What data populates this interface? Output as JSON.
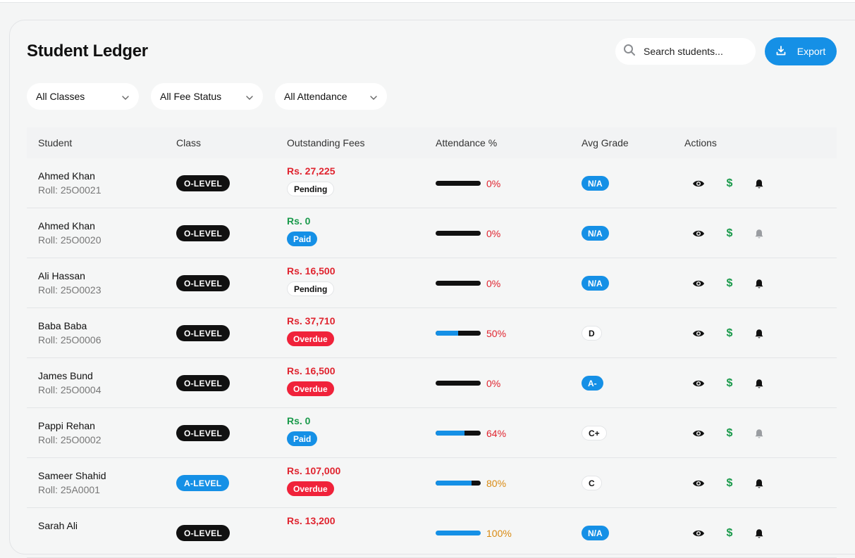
{
  "header": {
    "title": "Student Ledger"
  },
  "search": {
    "placeholder": "Search students..."
  },
  "export": {
    "label": "Export"
  },
  "filters": [
    {
      "label": "All Classes"
    },
    {
      "label": "All Fee Status"
    },
    {
      "label": "All Attendance"
    }
  ],
  "table": {
    "columns": [
      "Student",
      "Class",
      "Outstanding Fees",
      "Attendance %",
      "Avg Grade",
      "Actions"
    ],
    "rows": [
      {
        "name": "Ahmed Khan",
        "roll": "Roll: 25O0021",
        "class": "O-LEVEL",
        "fee": "Rs. 27,225",
        "status": "Pending",
        "attendance": 0,
        "attendance_label": "0%",
        "grade": "N/A",
        "reminder_enabled": true
      },
      {
        "name": "Ahmed Khan",
        "roll": "Roll: 25O0020",
        "class": "O-LEVEL",
        "fee": "Rs. 0",
        "status": "Paid",
        "attendance": 0,
        "attendance_label": "0%",
        "grade": "N/A",
        "reminder_enabled": false
      },
      {
        "name": "Ali Hassan",
        "roll": "Roll: 25O0023",
        "class": "O-LEVEL",
        "fee": "Rs. 16,500",
        "status": "Pending",
        "attendance": 0,
        "attendance_label": "0%",
        "grade": "N/A",
        "reminder_enabled": true
      },
      {
        "name": "Baba Baba",
        "roll": "Roll: 25O0006",
        "class": "O-LEVEL",
        "fee": "Rs. 37,710",
        "status": "Overdue",
        "attendance": 50,
        "attendance_label": "50%",
        "grade": "D",
        "reminder_enabled": true
      },
      {
        "name": "James Bund",
        "roll": "Roll: 25O0004",
        "class": "O-LEVEL",
        "fee": "Rs. 16,500",
        "status": "Overdue",
        "attendance": 0,
        "attendance_label": "0%",
        "grade": "A-",
        "reminder_enabled": true
      },
      {
        "name": "Pappi Rehan",
        "roll": "Roll: 25O0002",
        "class": "O-LEVEL",
        "fee": "Rs. 0",
        "status": "Paid",
        "attendance": 64,
        "attendance_label": "64%",
        "grade": "C+",
        "reminder_enabled": false
      },
      {
        "name": "Sameer Shahid",
        "roll": "Roll: 25A0001",
        "class": "A-LEVEL",
        "fee": "Rs. 107,000",
        "status": "Overdue",
        "attendance": 80,
        "attendance_label": "80%",
        "grade": "C",
        "reminder_enabled": true
      },
      {
        "name": "Sarah Ali",
        "roll": "",
        "class": "O-LEVEL",
        "fee": "Rs. 13,200",
        "status": "",
        "attendance": 100,
        "attendance_label": "100%",
        "grade": "N/A",
        "reminder_enabled": true
      }
    ]
  },
  "colors": {
    "accent": "#1590e6",
    "danger": "#f0223a",
    "fee_due": "#e0242f",
    "fee_paid": "#1a9a4b",
    "attendance_low": "#e0242f",
    "attendance_mid": "#d98a12",
    "dark_badge": "#111111"
  },
  "icons": {
    "view": "eye-icon",
    "pay": "dollar-icon",
    "remind": "bell-icon",
    "search": "search-icon",
    "export": "download-icon",
    "dropdown": "chevron-down-icon"
  }
}
